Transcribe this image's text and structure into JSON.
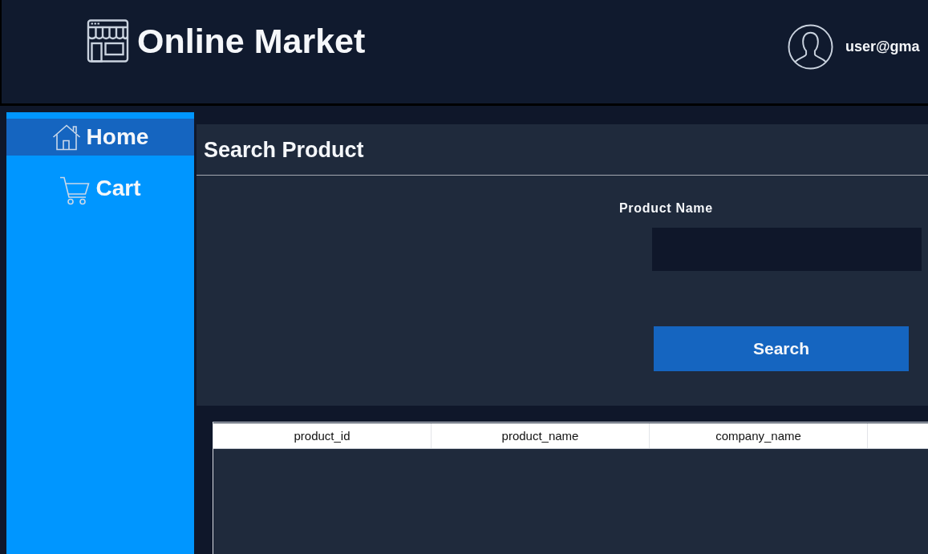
{
  "header": {
    "title": "Online Market",
    "user": "user@gma"
  },
  "sidebar": {
    "items": [
      {
        "label": "Home",
        "kind": "home",
        "selected": true
      },
      {
        "label": "Cart",
        "kind": "cart",
        "selected": false
      }
    ]
  },
  "search_panel": {
    "title": "Search Product",
    "field": {
      "label": "Product Name"
    },
    "button": "Search"
  },
  "table": {
    "columns": [
      "product_id",
      "product_name",
      "company_name"
    ]
  }
}
